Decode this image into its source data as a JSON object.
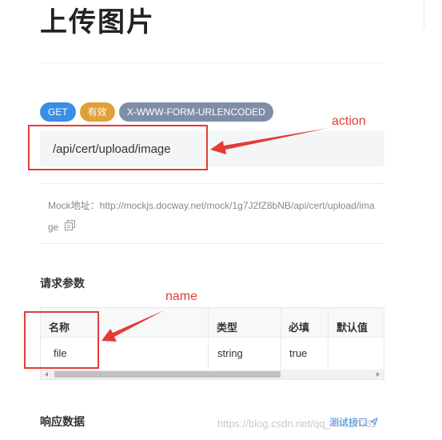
{
  "header": {
    "title": "上传图片"
  },
  "tags": {
    "method": "GET",
    "status": "有效",
    "content_type": "X-WWW-FORM-URLENCODED"
  },
  "endpoint": {
    "path": "/api/cert/upload/image"
  },
  "annotations": {
    "action": "action",
    "name": "name"
  },
  "mock": {
    "label": "Mock地址：",
    "url": "http://mockjs.docway.net/mock/1g7J2fZ8bNB/api/cert/upload/image"
  },
  "request_params": {
    "title": "请求参数",
    "columns": [
      "名称",
      "类型",
      "必填",
      "默认值"
    ],
    "rows": [
      {
        "name": "file",
        "type": "string",
        "required": "true",
        "default": ""
      }
    ]
  },
  "response": {
    "title": "响应数据",
    "test_link": "测试接口"
  },
  "watermark": "https://blog.csdn.net/qq_44817062",
  "colors": {
    "accent_blue": "#3a8ee6",
    "annotation_red": "#e23c36",
    "tag_orange": "#e0a03a",
    "tag_gray": "#7f8ea8"
  },
  "icons": {
    "copy": "copy-icon",
    "external": "external-link-icon"
  }
}
